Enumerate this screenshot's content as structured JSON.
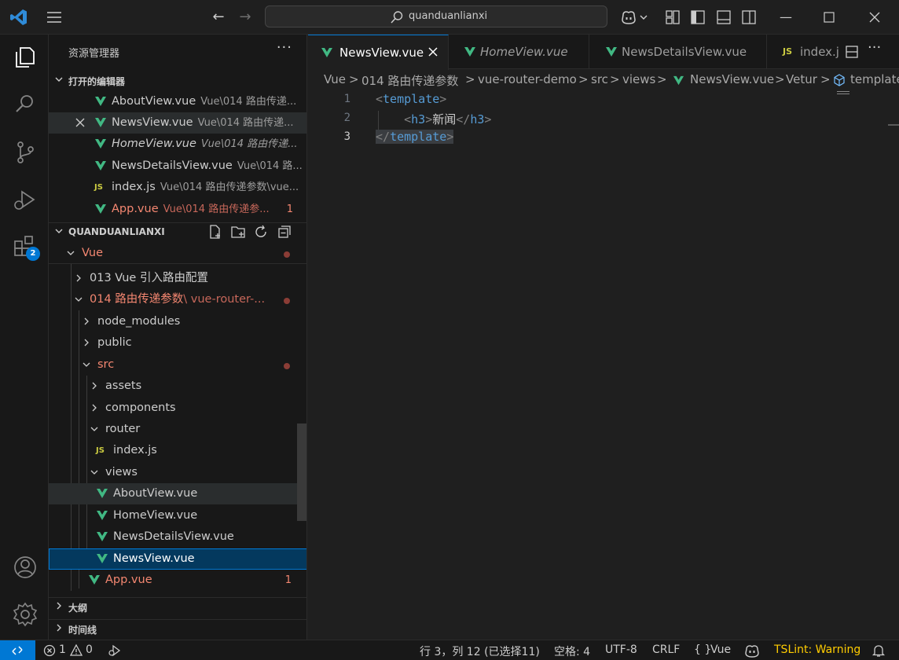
{
  "title_bar": {
    "search_text": "quanduanlianxi"
  },
  "activity_bar": {
    "extensions_badge": "2"
  },
  "sidebar": {
    "title": "资源管理器",
    "more": "···",
    "open_editors_header": "打开的编辑器",
    "open_editors": [
      {
        "name": "AboutView.vue",
        "desc": "Vue\\014 路由传递...",
        "type": "vue"
      },
      {
        "name": "NewsView.vue",
        "desc": "Vue\\014 路由传递...",
        "type": "vue"
      },
      {
        "name": "HomeView.vue",
        "desc": "Vue\\014 路由传递...",
        "type": "vue"
      },
      {
        "name": "NewsDetailsView.vue",
        "desc": "Vue\\014 路...",
        "type": "vue"
      },
      {
        "name": "index.js",
        "desc": "Vue\\014 路由传递参数\\vue...",
        "type": "js"
      },
      {
        "name": "App.vue",
        "desc": "Vue\\014 路由传递参...",
        "type": "vue",
        "problems": "1"
      }
    ],
    "workspace_header": "QUANDUANLIANXI",
    "tree": {
      "vue_folder": "Vue",
      "folder_013": "013 Vue 引入路由配置",
      "folder_014": "014 路由传递参数",
      "folder_014_suffix": "\\ vue-router-...",
      "node_modules": "node_modules",
      "public": "public",
      "src": "src",
      "assets": "assets",
      "components": "components",
      "router": "router",
      "index_js": "index.js",
      "views": "views",
      "about": "AboutView.vue",
      "home": "HomeView.vue",
      "news_details": "NewsDetailsView.vue",
      "news": "NewsView.vue",
      "app": "App.vue",
      "app_problems": "1"
    },
    "outline_header": "大纲",
    "timeline_header": "时间线",
    "js_label": "JS"
  },
  "tabs": [
    {
      "label": "NewsView.vue",
      "active": true
    },
    {
      "label": "HomeView.vue",
      "italic": true
    },
    {
      "label": "NewsDetailsView.vue"
    },
    {
      "label": "index.j"
    }
  ],
  "breadcrumb": {
    "items": [
      "Vue",
      "014 路由传递参数",
      "vue-router-demo",
      "src",
      "views",
      "NewsView.vue",
      "Vetur",
      "template"
    ],
    "sep": ">"
  },
  "editor": {
    "line_numbers": [
      "1",
      "2",
      "3"
    ],
    "line1": "template",
    "line2_tag": "h3",
    "line2_text": "新闻",
    "line3": "template"
  },
  "status_bar": {
    "errors": "1",
    "warnings": "0",
    "cursor": "行 3，列 12 (已选择11)",
    "spaces": "空格: 4",
    "encoding": "UTF-8",
    "eol": "CRLF",
    "language": "Vue",
    "tslint": "TSLint: Warning"
  }
}
